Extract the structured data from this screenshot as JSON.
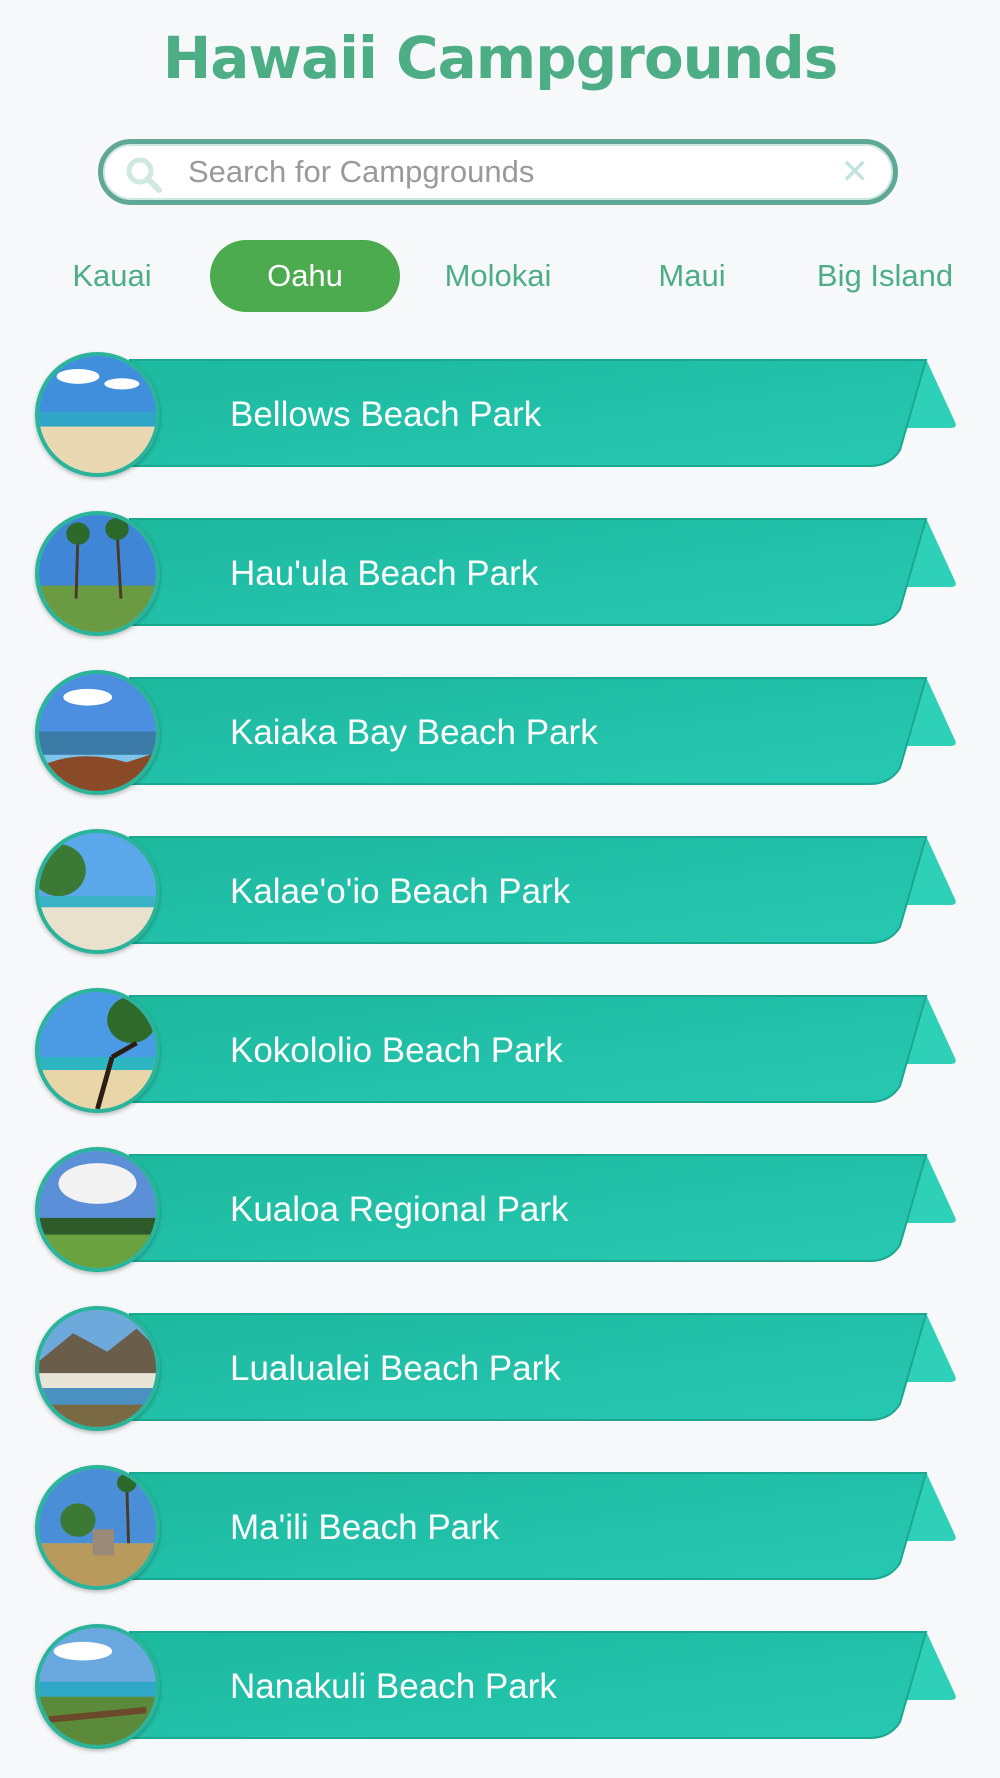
{
  "header": {
    "title": "Hawaii Campgrounds"
  },
  "search": {
    "placeholder": "Search for Campgrounds",
    "value": ""
  },
  "tabs": [
    {
      "label": "Kauai",
      "active": false
    },
    {
      "label": "Oahu",
      "active": true
    },
    {
      "label": "Molokai",
      "active": false
    },
    {
      "label": "Maui",
      "active": false
    },
    {
      "label": "Big Island",
      "active": false
    }
  ],
  "campgrounds": [
    {
      "name": "Bellows Beach Park",
      "thumb_icon": "beach-photo"
    },
    {
      "name": "Hau'ula Beach Park",
      "thumb_icon": "palm-trees-photo"
    },
    {
      "name": "Kaiaka Bay Beach Park",
      "thumb_icon": "bay-rocks-photo"
    },
    {
      "name": "Kalae'o'io Beach Park",
      "thumb_icon": "beach-trees-photo"
    },
    {
      "name": "Kokololio Beach Park",
      "thumb_icon": "beach-branches-photo"
    },
    {
      "name": "Kualoa Regional Park",
      "thumb_icon": "clouds-field-photo"
    },
    {
      "name": "Lualualei Beach Park",
      "thumb_icon": "mountain-coast-photo"
    },
    {
      "name": "Ma'ili Beach Park",
      "thumb_icon": "park-sign-photo"
    },
    {
      "name": "Nanakuli Beach Park",
      "thumb_icon": "canoes-photo"
    }
  ],
  "colors": {
    "accent": "#4dae86",
    "active_tab": "#4dab4f",
    "ribbon": "#22bea5",
    "ribbon_edge": "#1aa98f"
  }
}
